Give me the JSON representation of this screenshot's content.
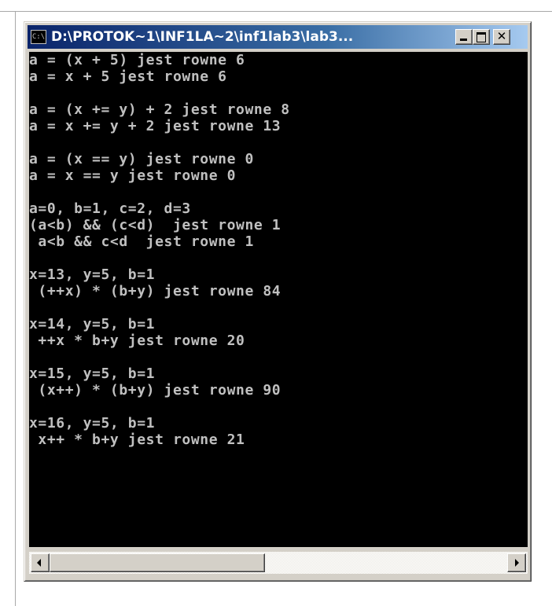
{
  "window": {
    "title": "D:\\PROTOK~1\\INF1LA~2\\inf1lab3\\lab3...",
    "icon_name": "console-app-icon",
    "icon_glyph": "C:\\",
    "buttons": {
      "minimize_icon": "minimize-icon",
      "maximize_icon": "maximize-icon",
      "close_icon": "close-icon",
      "close_glyph": "✕"
    }
  },
  "console": {
    "background_color": "#000000",
    "text_color": "#c0c0c0",
    "lines": [
      "a = (x + 5) jest rowne 6",
      "a = x + 5 jest rowne 6",
      "",
      "a = (x += y) + 2 jest rowne 8",
      "a = x += y + 2 jest rowne 13",
      "",
      "a = (x == y) jest rowne 0",
      "a = x == y jest rowne 0",
      "",
      "a=0, b=1, c=2, d=3",
      "(a<b) && (c<d)  jest rowne 1",
      " a<b && c<d  jest rowne 1",
      "",
      "x=13, y=5, b=1",
      " (++x) * (b+y) jest rowne 84",
      "",
      "x=14, y=5, b=1",
      " ++x * b+y jest rowne 20",
      "",
      "x=15, y=5, b=1",
      " (x++) * (b+y) jest rowne 90",
      "",
      "x=16, y=5, b=1",
      " x++ * b+y jest rowne 21",
      ""
    ]
  },
  "scrollbar": {
    "left_arrow_icon": "scroll-left-icon",
    "right_arrow_icon": "scroll-right-icon",
    "thumb_fraction": 0.47
  }
}
